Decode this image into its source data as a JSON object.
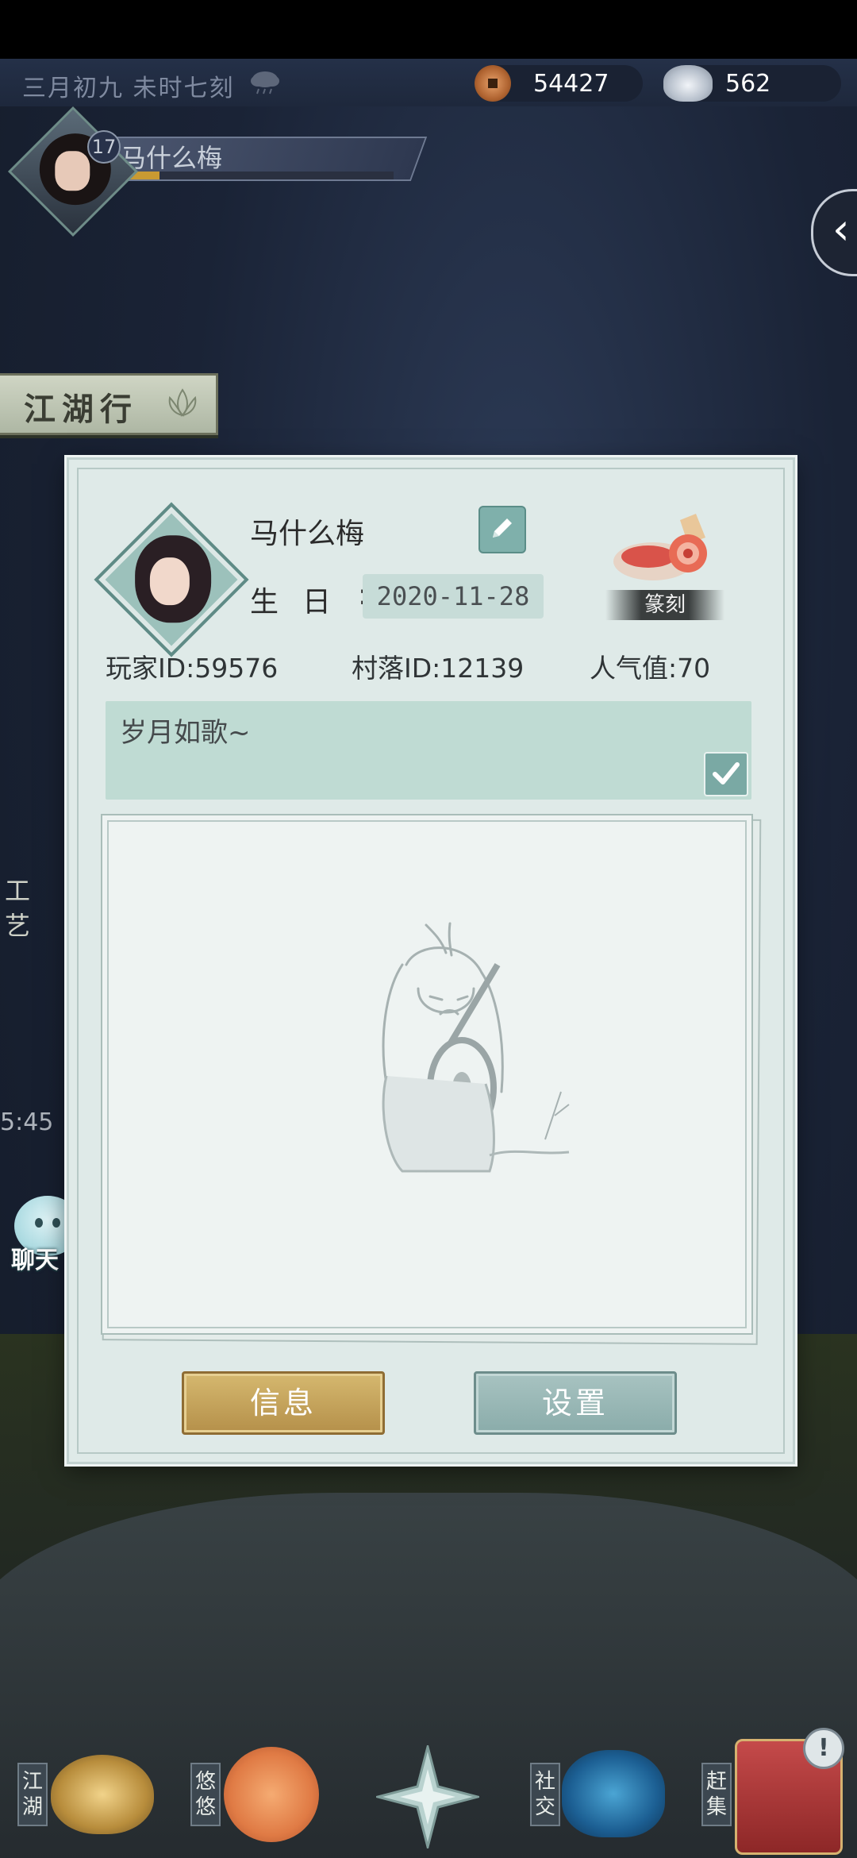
{
  "topbar": {
    "time_text": "三月初九  未时七刻",
    "weather_icon": "rain-cloud-icon",
    "copper_coins": "54427",
    "silver_ingots": "562"
  },
  "profile_chip": {
    "level": "17",
    "name": "马什么梅",
    "xp_fraction": 0.18
  },
  "side": {
    "jianghu_banner": "江湖行",
    "gongyi_label": "工艺",
    "time_fragment": "5:45",
    "chat_label": "聊天"
  },
  "dialog": {
    "name": "马什么梅",
    "birthday_label": "生日",
    "birthday_colon": ":",
    "birthday_value": "2020-11-28",
    "seal_label": "篆刻",
    "player_id": "玩家ID:59576",
    "village_id": "村落ID:12139",
    "popularity": "人气值:70",
    "motto": "岁月如歌~",
    "info_button": "信息",
    "settings_button": "设置"
  },
  "bottom_nav": {
    "jianghu": "江湖",
    "youyou": "悠悠",
    "social": "社交",
    "market": "赶集",
    "badge": "!"
  },
  "colors": {
    "dialog_bg": "#dfeae8",
    "accent_teal": "#7fb0ab",
    "info_button": "#c9a65c",
    "settings_button": "#97b8b6"
  }
}
